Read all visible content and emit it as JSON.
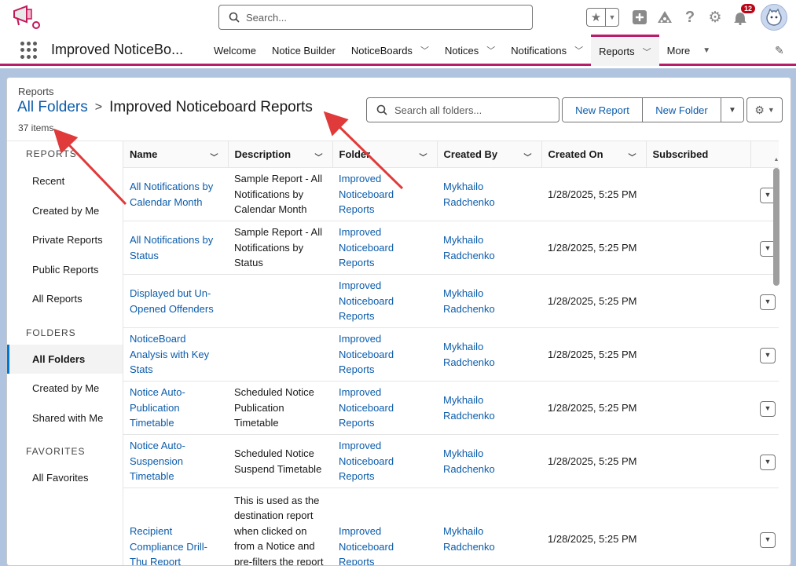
{
  "header": {
    "search_placeholder": "Search...",
    "notification_count": "12"
  },
  "nav": {
    "app_name": "Improved NoticeBo...",
    "items": [
      {
        "label": "Welcome"
      },
      {
        "label": "Notice Builder"
      },
      {
        "label": "NoticeBoards"
      },
      {
        "label": "Notices"
      },
      {
        "label": "Notifications"
      },
      {
        "label": "Reports"
      },
      {
        "label": "More"
      }
    ]
  },
  "page": {
    "object_label": "Reports",
    "breadcrumb_root": "All Folders",
    "title": "Improved Noticeboard Reports",
    "item_count": "37 items",
    "folder_search_placeholder": "Search all folders...",
    "new_report_label": "New Report",
    "new_folder_label": "New Folder"
  },
  "sidebar": {
    "reports_heading": "REPORTS",
    "report_items": [
      "Recent",
      "Created by Me",
      "Private Reports",
      "Public Reports",
      "All Reports"
    ],
    "folders_heading": "FOLDERS",
    "folder_items": [
      "All Folders",
      "Created by Me",
      "Shared with Me"
    ],
    "favorites_heading": "FAVORITES",
    "favorite_items": [
      "All Favorites"
    ]
  },
  "table": {
    "columns": [
      "Name",
      "Description",
      "Folder",
      "Created By",
      "Created On",
      "Subscribed"
    ],
    "rows": [
      {
        "name": "All Notifications by Calendar Month",
        "description": "Sample Report - All Notifications by Calendar Month",
        "folder": "Improved Noticeboard Reports",
        "created_by": "Mykhailo Radchenko",
        "created_on": "1/28/2025, 5:25 PM"
      },
      {
        "name": "All Notifications by Status",
        "description": "Sample Report - All Notifications by Status",
        "folder": "Improved Noticeboard Reports",
        "created_by": "Mykhailo Radchenko",
        "created_on": "1/28/2025, 5:25 PM"
      },
      {
        "name": "Displayed but Un-Opened Offenders",
        "description": "",
        "folder": "Improved Noticeboard Reports",
        "created_by": "Mykhailo Radchenko",
        "created_on": "1/28/2025, 5:25 PM"
      },
      {
        "name": "NoticeBoard Analysis with Key Stats",
        "description": "",
        "folder": "Improved Noticeboard Reports",
        "created_by": "Mykhailo Radchenko",
        "created_on": "1/28/2025, 5:25 PM"
      },
      {
        "name": "Notice Auto-Publication Timetable",
        "description": "Scheduled Notice Publication Timetable",
        "folder": "Improved Noticeboard Reports",
        "created_by": "Mykhailo Radchenko",
        "created_on": "1/28/2025, 5:25 PM"
      },
      {
        "name": "Notice Auto-Suspension Timetable",
        "description": "Scheduled Notice Suspend Timetable",
        "folder": "Improved Noticeboard Reports",
        "created_by": "Mykhailo Radchenko",
        "created_on": "1/28/2025, 5:25 PM"
      },
      {
        "name": "Recipient Compliance Drill-Thu Report",
        "description": "This is used as the destination report when clicked on from a Notice and pre-filters the report",
        "folder": "Improved Noticeboard Reports",
        "created_by": "Mykhailo Radchenko",
        "created_on": "1/28/2025, 5:25 PM"
      }
    ]
  },
  "colors": {
    "brand_pink": "#b81d6a",
    "link_blue": "#0b5cab",
    "page_background": "#b0c4df",
    "annotation_red": "#e03a3a"
  }
}
